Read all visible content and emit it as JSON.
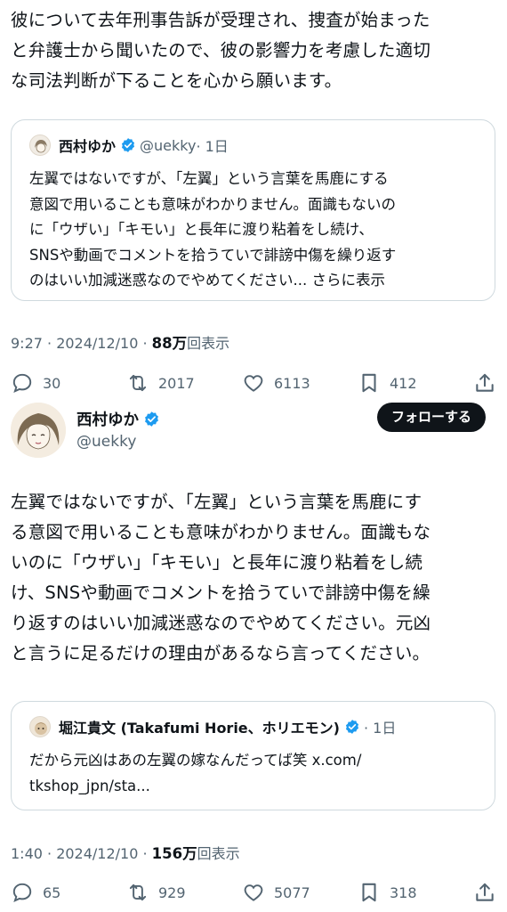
{
  "top_tweet": {
    "text_lines": [
      "彼について去年刑事告訴が受理され、捜査が始まった",
      "と弁護士から聞いたので、彼の影響力を考慮した適切",
      "な司法判断が下ることを心から願います。"
    ],
    "quote": {
      "name": "西村ゆか",
      "handle": "@uekky",
      "time": "· 1日",
      "text_lines": [
        "左翼ではないですが、「左翼」という言葉を馬鹿にする",
        "意図で用いることも意味がわかりません。面識もないの",
        "に「ウザい」「キモい」と長年に渡り粘着をし続け、",
        "SNSや動画でコメントを拾うていで誹謗中傷を繰り返す",
        "のはいい加減迷惑なのでやめてください..."
      ],
      "show_more": "さらに表示"
    },
    "meta": {
      "time": "9:27 · 2024/12/10 · ",
      "views": "88万",
      "views_label": "回表示"
    },
    "actions": {
      "replies": "30",
      "reposts": "2017",
      "likes": "6113",
      "bookmarks": "412"
    }
  },
  "author": {
    "name": "西村ゆか",
    "handle": "@uekky",
    "follow_label": "フォローする"
  },
  "main_tweet": {
    "text_lines": [
      "左翼ではないですが、「左翼」という言葉を馬鹿にす",
      "る意図で用いることも意味がわかりません。面識もな",
      "いのに「ウザい」「キモい」と長年に渡り粘着をし続",
      "け、SNSや動画でコメントを拾うていで誹謗中傷を繰",
      "り返すのはいい加減迷惑なのでやめてください。元凶",
      "と言うに足るだけの理由があるなら言ってください。"
    ],
    "quote": {
      "name": "堀江貴文 (Takafumi Horie、ホリエモン)",
      "time": "· 1日",
      "text_lines": [
        "だから元凶はあの左翼の嫁なんだってば笑 x.com/",
        "tkshop_jpn/sta..."
      ]
    },
    "meta": {
      "time": "1:40 · 2024/12/10 · ",
      "views": "156万",
      "views_label": "回表示"
    },
    "actions": {
      "replies": "65",
      "reposts": "929",
      "likes": "5077",
      "bookmarks": "318"
    }
  },
  "colors": {
    "accent": "#1d9bf0",
    "text": "#0f1419",
    "secondary": "#536471",
    "border": "#cfd9de"
  }
}
